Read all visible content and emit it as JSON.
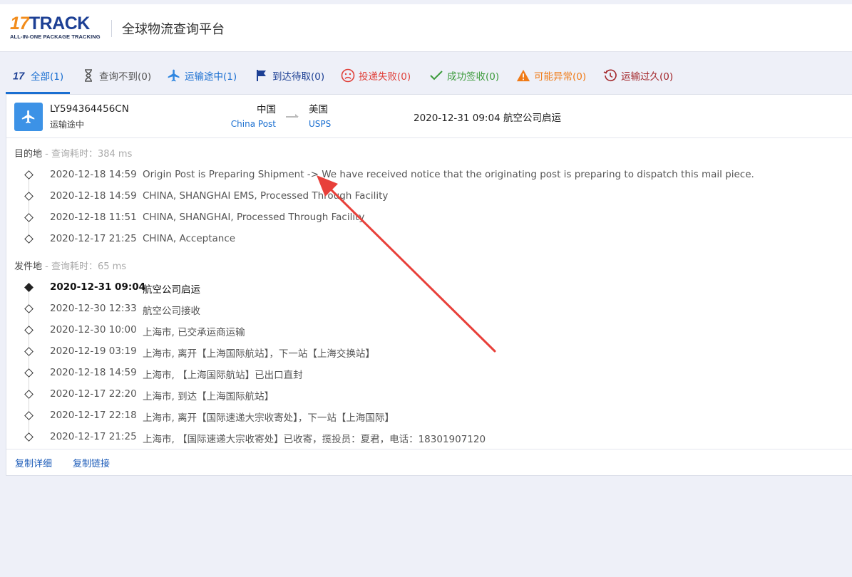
{
  "header": {
    "logo_17": "17",
    "logo_track": "TRACK",
    "logo_sub": "ALL-IN-ONE PACKAGE TRACKING",
    "title": "全球物流查询平台"
  },
  "tabs": [
    {
      "icon": "17track-logo-icon",
      "label": "全部(1)",
      "color": "#1a6fd1",
      "active": true
    },
    {
      "icon": "hourglass-icon",
      "label": "查询不到(0)",
      "color": "#555555"
    },
    {
      "icon": "airplane-icon",
      "label": "运输途中(1)",
      "color": "#1a6fd1"
    },
    {
      "icon": "flag-icon",
      "label": "到达待取(0)",
      "color": "#1c3f94"
    },
    {
      "icon": "sad-face-icon",
      "label": "投递失败(0)",
      "color": "#e0403a"
    },
    {
      "icon": "checkmark-icon",
      "label": "成功签收(0)",
      "color": "#3b9a3b"
    },
    {
      "icon": "warning-icon",
      "label": "可能异常(0)",
      "color": "#f07a16"
    },
    {
      "icon": "history-clock-icon",
      "label": "运输过久(0)",
      "color": "#a3262a"
    }
  ],
  "summary": {
    "icon": "airplane-icon",
    "tracking_number": "LY594364456CN",
    "status": "运输途中",
    "origin_country": "中国",
    "origin_carrier": "China Post",
    "dest_country": "美国",
    "dest_carrier": "USPS",
    "latest_event": "2020-12-31 09:04  航空公司启运"
  },
  "destination": {
    "label": "目的地",
    "meta": " - 查询耗时：384 ms",
    "events": [
      {
        "time": "2020-12-18 14:59",
        "desc": "Origin Post is Preparing Shipment -> We have received notice that the originating post is preparing to dispatch this mail piece."
      },
      {
        "time": "2020-12-18 14:59",
        "desc": "CHINA, SHANGHAI EMS, Processed Through Facility"
      },
      {
        "time": "2020-12-18 11:51",
        "desc": "CHINA, SHANGHAI, Processed Through Facility"
      },
      {
        "time": "2020-12-17 21:25",
        "desc": "CHINA, Acceptance"
      }
    ]
  },
  "origin": {
    "label": "发件地",
    "meta": " - 查询耗时：65 ms",
    "events": [
      {
        "time": "2020-12-31 09:04",
        "desc": "航空公司启运",
        "latest": true
      },
      {
        "time": "2020-12-30 12:33",
        "desc": "航空公司接收"
      },
      {
        "time": "2020-12-30 10:00",
        "desc": "上海市, 已交承运商运输"
      },
      {
        "time": "2020-12-19 03:19",
        "desc": "上海市, 离开【上海国际航站】，下一站【上海交换站】"
      },
      {
        "time": "2020-12-18 14:59",
        "desc": "上海市, 【上海国际航站】已出口直封"
      },
      {
        "time": "2020-12-17 22:20",
        "desc": "上海市, 到达【上海国际航站】"
      },
      {
        "time": "2020-12-17 22:18",
        "desc": "上海市, 离开【国际速递大宗收寄处】，下一站【上海国际】"
      },
      {
        "time": "2020-12-17 21:25",
        "desc": "上海市, 【国际速递大宗收寄处】已收寄，揽投员：夏君，电话：18301907120"
      }
    ]
  },
  "footer": {
    "copy_details": "复制详细",
    "copy_link": "复制链接"
  },
  "colors": {
    "accent": "#1a6fd1",
    "annotation_arrow": "#e8403a"
  }
}
